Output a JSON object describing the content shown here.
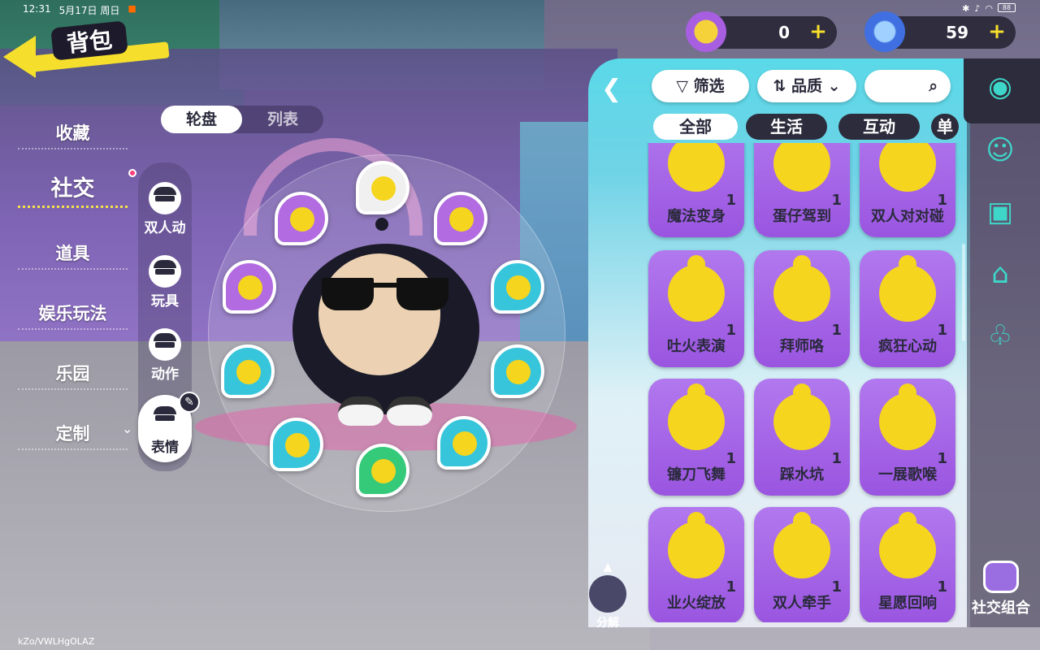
{
  "status_bar": {
    "time": "12:31",
    "date": "5月17日 周日",
    "battery": "88"
  },
  "header": {
    "title": "背包"
  },
  "currency": [
    {
      "icon": "gold-coin-icon",
      "value": "0"
    },
    {
      "icon": "blue-gem-icon",
      "value": "59"
    }
  ],
  "categories": [
    "收藏",
    "社交",
    "道具",
    "娱乐玩法",
    "乐园",
    "定制"
  ],
  "active_category": "社交",
  "view_toggle": [
    "轮盘",
    "列表"
  ],
  "sub_categories": [
    "双人动",
    "玩具",
    "动作",
    "表情"
  ],
  "active_sub_category": "表情",
  "toolbar": {
    "filter": "筛选",
    "quality": "品质"
  },
  "tabs": [
    "全部",
    "生活",
    "互动",
    "单"
  ],
  "items": [
    {
      "name": "魔法变身",
      "count": "1"
    },
    {
      "name": "蛋仔驾到",
      "count": "1"
    },
    {
      "name": "双人对对碰",
      "count": "1"
    },
    {
      "name": "吐火表演",
      "count": "1"
    },
    {
      "name": "拜师咯",
      "count": "1"
    },
    {
      "name": "疯狂心动",
      "count": "1"
    },
    {
      "name": "镰刀飞舞",
      "count": "1"
    },
    {
      "name": "踩水坑",
      "count": "1"
    },
    {
      "name": "一展歌喉",
      "count": "1"
    },
    {
      "name": "业火绽放",
      "count": "1"
    },
    {
      "name": "双人牵手",
      "count": "1"
    },
    {
      "name": "星愿回响",
      "count": "1"
    }
  ],
  "combo_label": "社交组合",
  "decompose_label": "分解",
  "watermark": "kZo/VWLHgOLAZ",
  "colors": {
    "card": "#a465e6",
    "accent": "#f6df2c",
    "panel": "#5ad9e8"
  }
}
